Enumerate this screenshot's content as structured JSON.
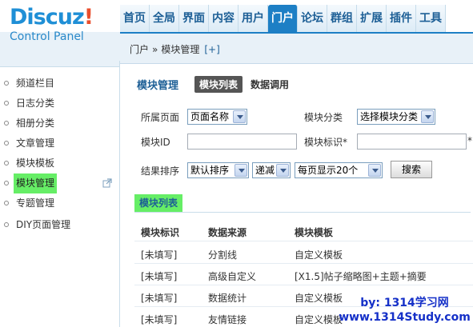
{
  "header": {
    "logo_brand": "Discuz",
    "logo_bang": "!",
    "logo_sub": "Control Panel",
    "nav": [
      "首页",
      "全局",
      "界面",
      "内容",
      "用户",
      "门户",
      "论坛",
      "群组",
      "扩展",
      "插件",
      "工具"
    ],
    "active_nav": "门户"
  },
  "crumb": {
    "section": "门户",
    "sep": "»",
    "page": "模块管理",
    "add": "[+]"
  },
  "sidebar": {
    "items": [
      {
        "label": "频道栏目"
      },
      {
        "label": "日志分类"
      },
      {
        "label": "相册分类"
      },
      {
        "label": "文章管理"
      },
      {
        "label": "模块模板"
      },
      {
        "label": "模块管理"
      },
      {
        "label": "专题管理"
      },
      {
        "label": "DIY页面管理"
      }
    ],
    "active": "模块管理"
  },
  "main": {
    "title": "模块管理",
    "tab_active": "模块列表",
    "tab_other": "数据调用",
    "filters": {
      "page_label": "所属页面",
      "page_value": "页面名称",
      "category_label": "模块分类",
      "category_value": "选择模块分类",
      "id_label": "模块ID",
      "id_value": "",
      "tag_label": "模块标识*",
      "tag_value": "",
      "tag_star": "*",
      "sort_label": "结果排序",
      "sort_value": "默认排序",
      "order_value": "递减",
      "perpage_value": "每页显示20个",
      "search_button": "搜索"
    },
    "section_title": "模块列表",
    "table": {
      "headers": [
        "模块标识",
        "数据来源",
        "模块模板"
      ],
      "rows": [
        [
          "[未填写]",
          "分割线",
          "自定义模板"
        ],
        [
          "[未填写]",
          "高级自定义",
          "[X1.5]帖子缩略图+主题+摘要"
        ],
        [
          "[未填写]",
          "数据统计",
          "自定义模板"
        ],
        [
          "[未填写]",
          "友情链接",
          "自定义模板"
        ]
      ]
    }
  },
  "watermark": {
    "line1": "by: 1314学习网",
    "line2": "www.1314Study.com"
  },
  "colors": {
    "accent": "#1d7fc5",
    "highlight": "#66ee66",
    "watermark": "#1530c8"
  }
}
